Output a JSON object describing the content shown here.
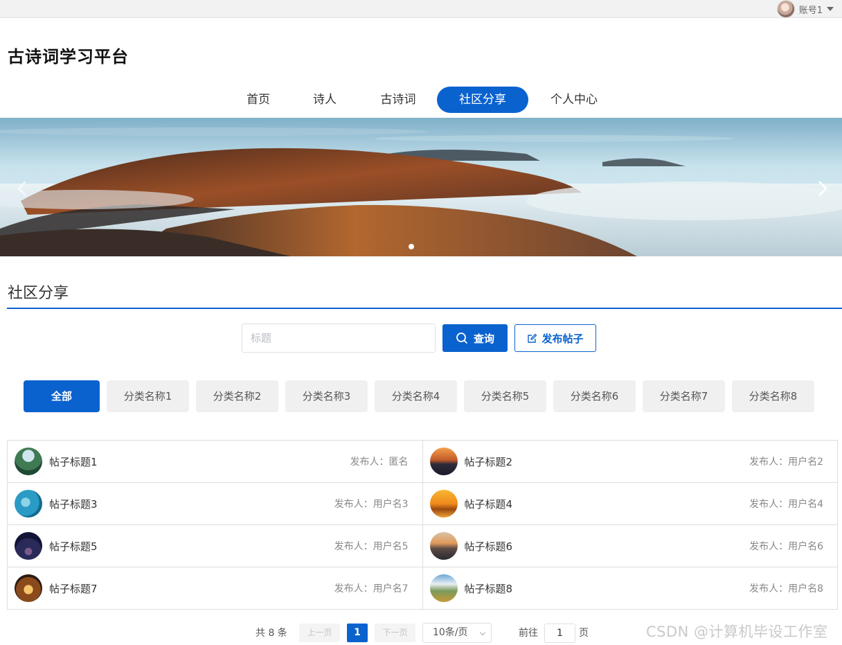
{
  "topbar": {
    "account_name": "账号1"
  },
  "header": {
    "site_title": "古诗词学习平台"
  },
  "nav": {
    "items": [
      {
        "label": "首页"
      },
      {
        "label": "诗人"
      },
      {
        "label": "古诗词"
      },
      {
        "label": "社区分享",
        "active": true
      },
      {
        "label": "个人中心"
      }
    ]
  },
  "banner": {
    "slides": 1,
    "current_slide": 1
  },
  "section": {
    "title": "社区分享"
  },
  "search": {
    "placeholder": "标题",
    "value": "",
    "query_label": "查询",
    "post_label": "发布帖子"
  },
  "categories": [
    {
      "label": "全部",
      "active": true
    },
    {
      "label": "分类名称1"
    },
    {
      "label": "分类名称2"
    },
    {
      "label": "分类名称3"
    },
    {
      "label": "分类名称4"
    },
    {
      "label": "分类名称5"
    },
    {
      "label": "分类名称6"
    },
    {
      "label": "分类名称7"
    },
    {
      "label": "分类名称8"
    }
  ],
  "posts": [
    {
      "title": "帖子标题1",
      "author": "发布人：匿名",
      "thumb": "forest-lake"
    },
    {
      "title": "帖子标题2",
      "author": "发布人：用户名2",
      "thumb": "sunset-pier"
    },
    {
      "title": "帖子标题3",
      "author": "发布人：用户名3",
      "thumb": "blue-water"
    },
    {
      "title": "帖子标题4",
      "author": "发布人：用户名4",
      "thumb": "golden-sunset"
    },
    {
      "title": "帖子标题5",
      "author": "发布人：用户名5",
      "thumb": "night-sky"
    },
    {
      "title": "帖子标题6",
      "author": "发布人：用户名6",
      "thumb": "beach-dusk"
    },
    {
      "title": "帖子标题7",
      "author": "发布人：用户名7",
      "thumb": "lit-house"
    },
    {
      "title": "帖子标题8",
      "author": "发布人：用户名8",
      "thumb": "mountain-meadow"
    }
  ],
  "pagination": {
    "total_text": "共 8 条",
    "prev_label": "上一页",
    "current_page": "1",
    "next_label": "下一页",
    "page_size": "10条/页",
    "goto_label": "前往",
    "goto_value": "1",
    "page_suffix": "页"
  },
  "watermark": "CSDN @计算机毕设工作室",
  "colors": {
    "accent": "#0a62cf"
  }
}
